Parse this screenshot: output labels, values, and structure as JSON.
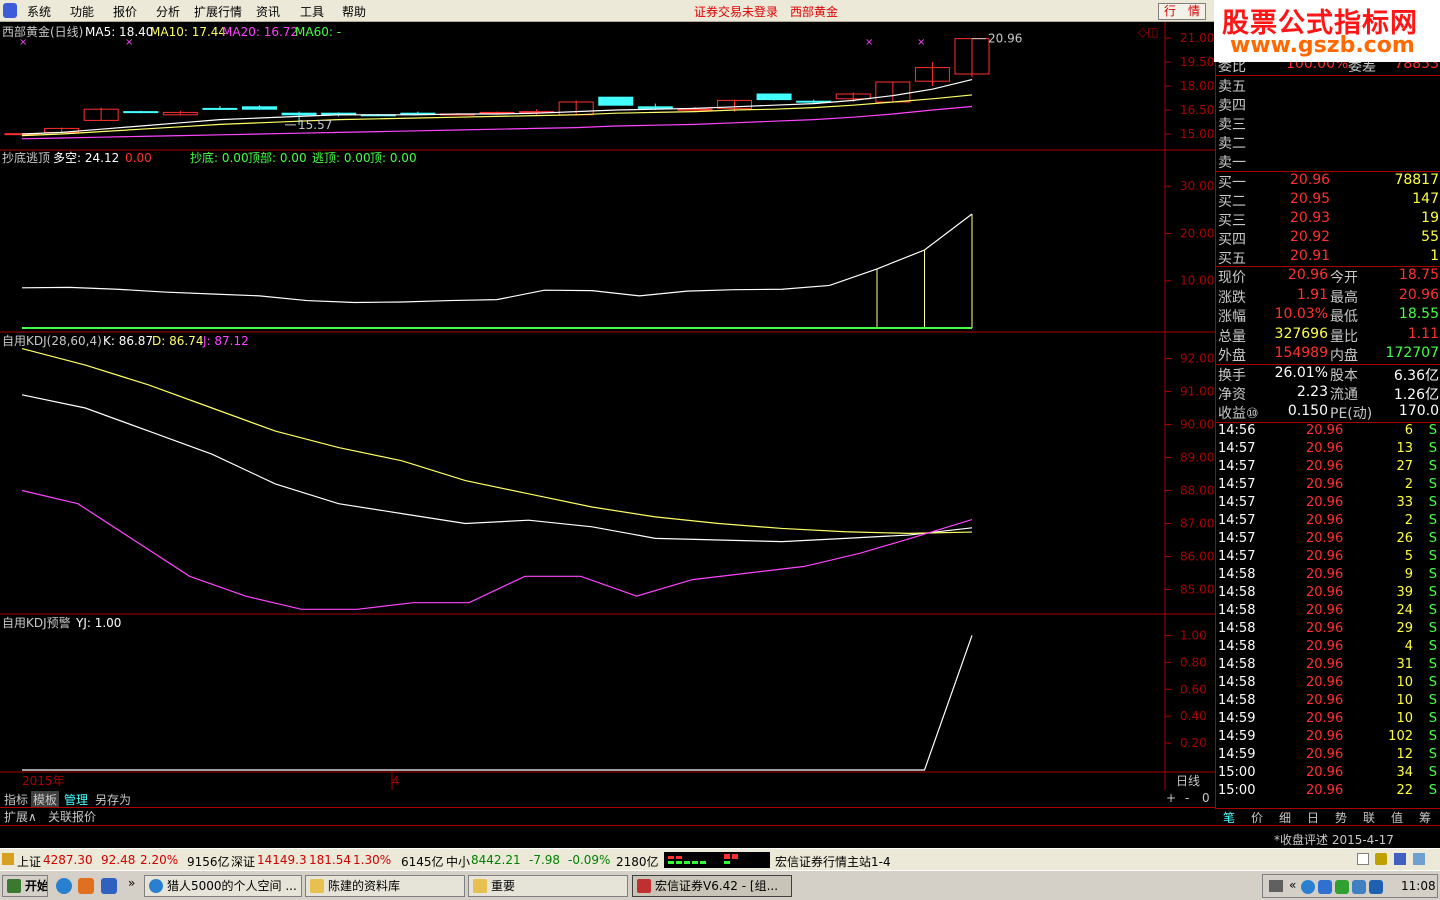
{
  "menu": {
    "items": [
      "系统",
      "功能",
      "报价",
      "分析",
      "扩展行情",
      "资讯",
      "工具",
      "帮助"
    ],
    "center": "证券交易未登录",
    "center2": "西部黄金",
    "quote_btn": "行　情"
  },
  "watermark": {
    "title": "股票公式指标网",
    "url": "www.gszb.com"
  },
  "main_panel": {
    "stock_title": "西部黄金(日线)",
    "ma5": "MA5: 18.40",
    "ma10": "MA10: 17.44",
    "ma20": "MA20: 16.72",
    "ma60": "MA60: -",
    "y_ticks": [
      "21.00",
      "19.50",
      "18.00",
      "16.50",
      "15.00"
    ],
    "high_label": "20.96",
    "low_label": "15.57"
  },
  "panel2": {
    "name": "抄底逃顶",
    "v1": "多空: 24.12",
    "v2": "0.00",
    "v3": "抄底: 0.00",
    "v4": "顶部: 0.00",
    "v5": "逃顶: 0.00",
    "v6": "顶: 0.00",
    "y_ticks": [
      "30.00",
      "20.00",
      "10.00"
    ]
  },
  "panel3": {
    "name": "自用KDJ(28,60,4)",
    "k": "K: 86.87",
    "d": "D: 86.74",
    "j": "J: 87.12",
    "y_ticks": [
      "92.00",
      "91.00",
      "90.00",
      "89.00",
      "88.00",
      "87.00",
      "86.00",
      "85.00"
    ]
  },
  "panel4": {
    "name": "自用KDJ预警",
    "yj": "YJ: 1.00",
    "y_ticks": [
      "1.00",
      "0.80",
      "0.60",
      "0.40",
      "0.20"
    ]
  },
  "xaxis": {
    "year": "2015年",
    "month": "4",
    "period": "日线"
  },
  "bottom_tabs": [
    "指标",
    "模板",
    "管理",
    "另存为"
  ],
  "bottom_tabs2": [
    "扩展∧",
    "关联报价"
  ],
  "zoom": [
    "+",
    "-",
    "0"
  ],
  "side": {
    "top_label1": "委比",
    "top_val1": "100.00%",
    "top_label2": "委差",
    "top_val2": "78853",
    "sells": [
      "卖五",
      "卖四",
      "卖三",
      "卖二",
      "卖一"
    ],
    "buys": [
      {
        "l": "买一",
        "p": "20.96",
        "v": "78817"
      },
      {
        "l": "买二",
        "p": "20.95",
        "v": "147"
      },
      {
        "l": "买三",
        "p": "20.93",
        "v": "19"
      },
      {
        "l": "买四",
        "p": "20.92",
        "v": "55"
      },
      {
        "l": "买五",
        "p": "20.91",
        "v": "1"
      }
    ],
    "stats": [
      {
        "l1": "现价",
        "v1": "20.96",
        "l2": "今开",
        "v2": "18.75"
      },
      {
        "l1": "涨跌",
        "v1": "1.91",
        "l2": "最高",
        "v2": "20.96"
      },
      {
        "l1": "涨幅",
        "v1": "10.03%",
        "l2": "最低",
        "v2": "18.55"
      },
      {
        "l1": "总量",
        "v1": "327696",
        "l2": "量比",
        "v2": "1.11"
      },
      {
        "l1": "外盘",
        "v1": "154989",
        "l2": "内盘",
        "v2": "172707"
      }
    ],
    "stats2": [
      {
        "l1": "换手",
        "v1": "26.01%",
        "l2": "股本",
        "v2": "6.36亿"
      },
      {
        "l1": "净资",
        "v1": "2.23",
        "l2": "流通",
        "v2": "1.26亿"
      },
      {
        "l1": "收益⑩",
        "v1": "0.150",
        "l2": "PE(动)",
        "v2": "170.0"
      }
    ],
    "ticks": [
      [
        "14:56",
        "20.96",
        "6",
        "S"
      ],
      [
        "14:57",
        "20.96",
        "13",
        "S"
      ],
      [
        "14:57",
        "20.96",
        "27",
        "S"
      ],
      [
        "14:57",
        "20.96",
        "2",
        "S"
      ],
      [
        "14:57",
        "20.96",
        "33",
        "S"
      ],
      [
        "14:57",
        "20.96",
        "2",
        "S"
      ],
      [
        "14:57",
        "20.96",
        "26",
        "S"
      ],
      [
        "14:57",
        "20.96",
        "5",
        "S"
      ],
      [
        "14:58",
        "20.96",
        "9",
        "S"
      ],
      [
        "14:58",
        "20.96",
        "39",
        "S"
      ],
      [
        "14:58",
        "20.96",
        "24",
        "S"
      ],
      [
        "14:58",
        "20.96",
        "29",
        "S"
      ],
      [
        "14:58",
        "20.96",
        "4",
        "S"
      ],
      [
        "14:58",
        "20.96",
        "31",
        "S"
      ],
      [
        "14:58",
        "20.96",
        "10",
        "S"
      ],
      [
        "14:58",
        "20.96",
        "10",
        "S"
      ],
      [
        "14:59",
        "20.96",
        "10",
        "S"
      ],
      [
        "14:59",
        "20.96",
        "102",
        "S"
      ],
      [
        "14:59",
        "20.96",
        "12",
        "S"
      ],
      [
        "15:00",
        "20.96",
        "34",
        "S"
      ],
      [
        "15:00",
        "20.96",
        "22",
        "S"
      ]
    ],
    "tabs": [
      "笔",
      "价",
      "细",
      "日",
      "势",
      "联",
      "值",
      "筹"
    ]
  },
  "status": {
    "note": "*收盘评述 2015-4-17"
  },
  "index": {
    "sh_name": "上证",
    "sh_val": "4287.30",
    "sh_chg": "92.48",
    "sh_pct": "2.20%",
    "sh_amt": "9156亿",
    "sz_name": "深证",
    "sz_val": "14149.3",
    "sz_chg": "181.54",
    "sz_pct": "1.30%",
    "sz_amt": "6145亿",
    "zx_name": "中小",
    "zx_val": "8442.21",
    "zx_chg": "-7.98",
    "zx_pct": "-0.09%",
    "zx_amt": "2180亿",
    "server": "宏信证券行情主站1-4"
  },
  "taskbar": {
    "start": "开始",
    "windows": [
      "猎人5000的个人空间 ...",
      "陈建的资料库",
      "重要",
      "宏信证券V6.42 - [组..."
    ],
    "clock": "11:08"
  },
  "chart_data": [
    {
      "type": "candlestick",
      "title": "西部黄金(日线)",
      "ylim": [
        14.5,
        21.5
      ],
      "ohlc": [
        [
          15.0,
          15.05,
          14.9,
          15.02
        ],
        [
          15.1,
          15.4,
          15.05,
          15.35
        ],
        [
          15.85,
          16.65,
          15.85,
          16.55
        ],
        [
          16.4,
          16.45,
          16.3,
          16.35
        ],
        [
          16.2,
          16.45,
          16.15,
          16.35
        ],
        [
          16.6,
          16.75,
          16.5,
          16.55
        ],
        [
          16.7,
          16.8,
          16.5,
          16.55
        ],
        [
          16.3,
          16.4,
          15.57,
          16.2
        ],
        [
          16.3,
          16.35,
          16.1,
          16.2
        ],
        [
          16.2,
          16.25,
          16.1,
          16.15
        ],
        [
          16.3,
          16.4,
          16.2,
          16.25
        ],
        [
          16.2,
          16.3,
          16.15,
          16.25
        ],
        [
          16.3,
          16.4,
          16.2,
          16.35
        ],
        [
          16.35,
          16.55,
          16.2,
          16.4
        ],
        [
          16.2,
          17.1,
          16.2,
          17.0
        ],
        [
          17.3,
          17.3,
          16.8,
          16.8
        ],
        [
          16.7,
          16.9,
          16.5,
          16.6
        ],
        [
          16.5,
          16.7,
          16.4,
          16.55
        ],
        [
          16.6,
          17.15,
          16.4,
          17.1
        ],
        [
          17.5,
          17.5,
          17.1,
          17.15
        ],
        [
          17.05,
          17.15,
          16.9,
          17.0
        ],
        [
          17.2,
          17.6,
          17.0,
          17.5
        ],
        [
          17.0,
          18.25,
          17.0,
          18.25
        ],
        [
          18.3,
          19.5,
          18.0,
          19.15
        ],
        [
          18.75,
          20.96,
          18.55,
          20.96
        ]
      ],
      "series": [
        {
          "name": "MA5",
          "values": [
            15.0,
            15.1,
            15.3,
            15.5,
            15.7,
            15.9,
            16.0,
            16.1,
            16.2,
            16.2,
            16.2,
            16.25,
            16.25,
            16.3,
            16.4,
            16.5,
            16.55,
            16.6,
            16.7,
            16.8,
            16.9,
            17.1,
            17.4,
            17.8,
            18.4
          ]
        },
        {
          "name": "MA10",
          "values": [
            14.9,
            15.0,
            15.15,
            15.3,
            15.45,
            15.6,
            15.7,
            15.8,
            15.9,
            15.95,
            16.0,
            16.05,
            16.1,
            16.15,
            16.2,
            16.3,
            16.35,
            16.4,
            16.5,
            16.55,
            16.65,
            16.8,
            17.0,
            17.2,
            17.44
          ]
        },
        {
          "name": "MA20",
          "values": [
            14.7,
            14.75,
            14.8,
            14.85,
            14.9,
            14.95,
            15.0,
            15.05,
            15.1,
            15.15,
            15.2,
            15.25,
            15.3,
            15.35,
            15.4,
            15.5,
            15.55,
            15.6,
            15.7,
            15.8,
            15.9,
            16.05,
            16.25,
            16.5,
            16.72
          ]
        }
      ]
    },
    {
      "type": "line",
      "title": "抄底逃顶",
      "ylim": [
        0,
        33
      ],
      "series": [
        {
          "name": "多空",
          "values": [
            8.5,
            8.6,
            8.2,
            7.6,
            7.2,
            6.8,
            5.8,
            5.4,
            5.5,
            5.8,
            6.0,
            8.0,
            7.9,
            6.8,
            7.8,
            8.1,
            8.2,
            9.0,
            12.5,
            16.5,
            24.12
          ]
        }
      ]
    },
    {
      "type": "line",
      "title": "自用KDJ(28,60,4)",
      "ylim": [
        84.5,
        92.5
      ],
      "series": [
        {
          "name": "K",
          "values": [
            90.9,
            90.5,
            89.8,
            89.1,
            88.2,
            87.6,
            87.3,
            87.0,
            87.1,
            86.9,
            86.55,
            86.5,
            86.45,
            86.55,
            86.65,
            86.87
          ]
        },
        {
          "name": "D",
          "values": [
            92.3,
            91.8,
            91.2,
            90.5,
            89.8,
            89.3,
            88.9,
            88.3,
            87.9,
            87.5,
            87.2,
            87.0,
            86.85,
            86.75,
            86.7,
            86.74
          ]
        },
        {
          "name": "J",
          "values": [
            88.0,
            87.6,
            86.5,
            85.4,
            84.8,
            84.4,
            84.4,
            84.6,
            84.6,
            85.4,
            85.4,
            84.8,
            85.3,
            85.5,
            85.7,
            86.1,
            86.6,
            87.12
          ]
        }
      ]
    },
    {
      "type": "line",
      "title": "自用KDJ预警",
      "ylim": [
        0,
        1.1
      ],
      "series": [
        {
          "name": "YJ",
          "values": [
            0,
            0,
            0,
            0,
            0,
            0,
            0,
            0,
            0,
            0,
            0,
            0,
            0,
            0,
            0,
            0,
            0,
            0,
            0,
            0,
            1.0
          ]
        }
      ]
    }
  ]
}
